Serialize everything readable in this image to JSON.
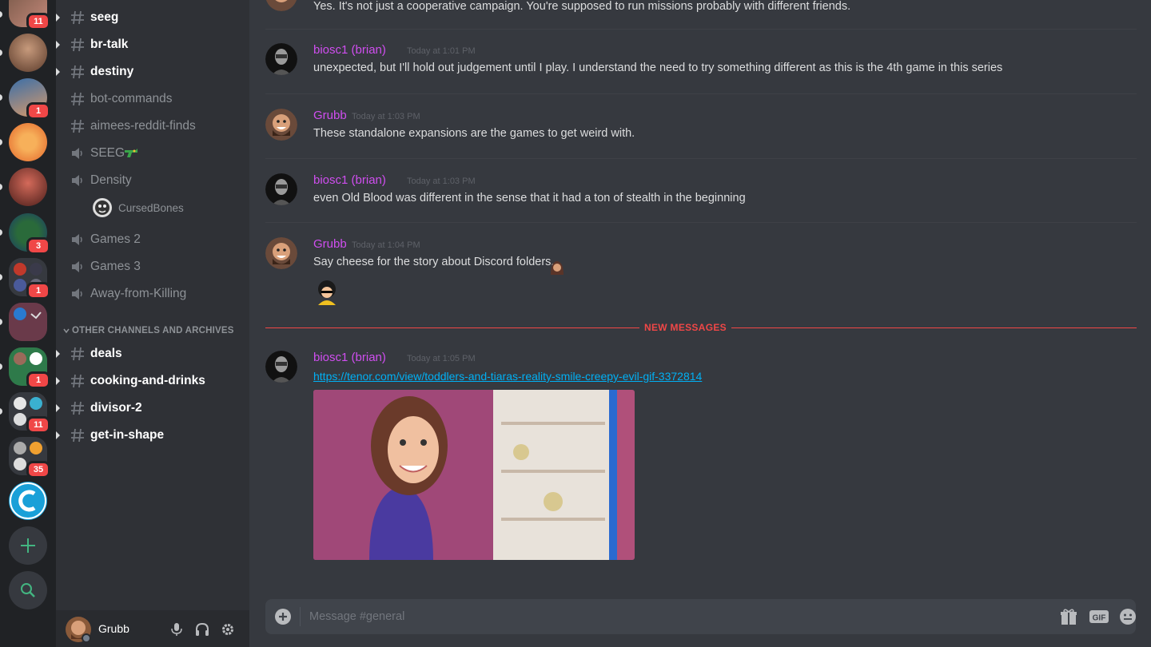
{
  "rail": {
    "badges": [
      "11",
      "1",
      "3",
      "1",
      "1",
      "11",
      "35"
    ]
  },
  "sidebar": {
    "channels_top": [
      {
        "label": "seeg"
      },
      {
        "label": "br-talk"
      },
      {
        "label": "destiny"
      },
      {
        "label": "bot-commands"
      },
      {
        "label": "aimees-reddit-finds"
      }
    ],
    "voice_channels": [
      {
        "label": "SEEG"
      },
      {
        "label": "Density"
      },
      {
        "label": "Games 2"
      },
      {
        "label": "Games 3"
      },
      {
        "label": "Away-from-Killing"
      }
    ],
    "voice_user": "CursedBones",
    "category": "OTHER CHANNELS AND ARCHIVES",
    "channels_bottom": [
      {
        "label": "deals"
      },
      {
        "label": "cooking-and-drinks"
      },
      {
        "label": "divisor-2"
      },
      {
        "label": "get-in-shape"
      }
    ],
    "user": {
      "name": "Grubb"
    }
  },
  "chat": {
    "top_text": "Yes. It's not just a cooperative campaign. You're supposed to run missions probably with different friends.",
    "messages": [
      {
        "author": "biosc1 (brian)",
        "time": "Today at 1:01 PM",
        "text": "unexpected, but I'll hold out judgement until I play.  I understand the need to try something different as this is the 4th game in this series"
      },
      {
        "author": "Grubb",
        "time": "Today at 1:03 PM",
        "text": "These standalone expansions are the games to get weird with."
      },
      {
        "author": "biosc1 (brian)",
        "time": "Today at 1:03 PM",
        "text": "even Old Blood was different in the sense that it had a ton of stealth in the beginning"
      },
      {
        "author": "Grubb",
        "time": "Today at 1:04 PM",
        "text": "Say cheese for the story about Discord folders."
      },
      {
        "author": "biosc1 (brian)",
        "time": "Today at 1:05 PM",
        "link": "https://tenor.com/view/toddlers-and-tiaras-reality-smile-creepy-evil-gif-3372814"
      }
    ],
    "new_messages_label": "NEW MESSAGES",
    "composer_placeholder": "Message #general"
  },
  "colors": {
    "rail_bg": "#202225",
    "sidebar_bg": "#2f3136",
    "chat_bg": "#36393f",
    "author_color": "#d04ef0",
    "link_color": "#00b0f4",
    "new_messages_color": "#f04747",
    "badge_color": "#f04747"
  }
}
